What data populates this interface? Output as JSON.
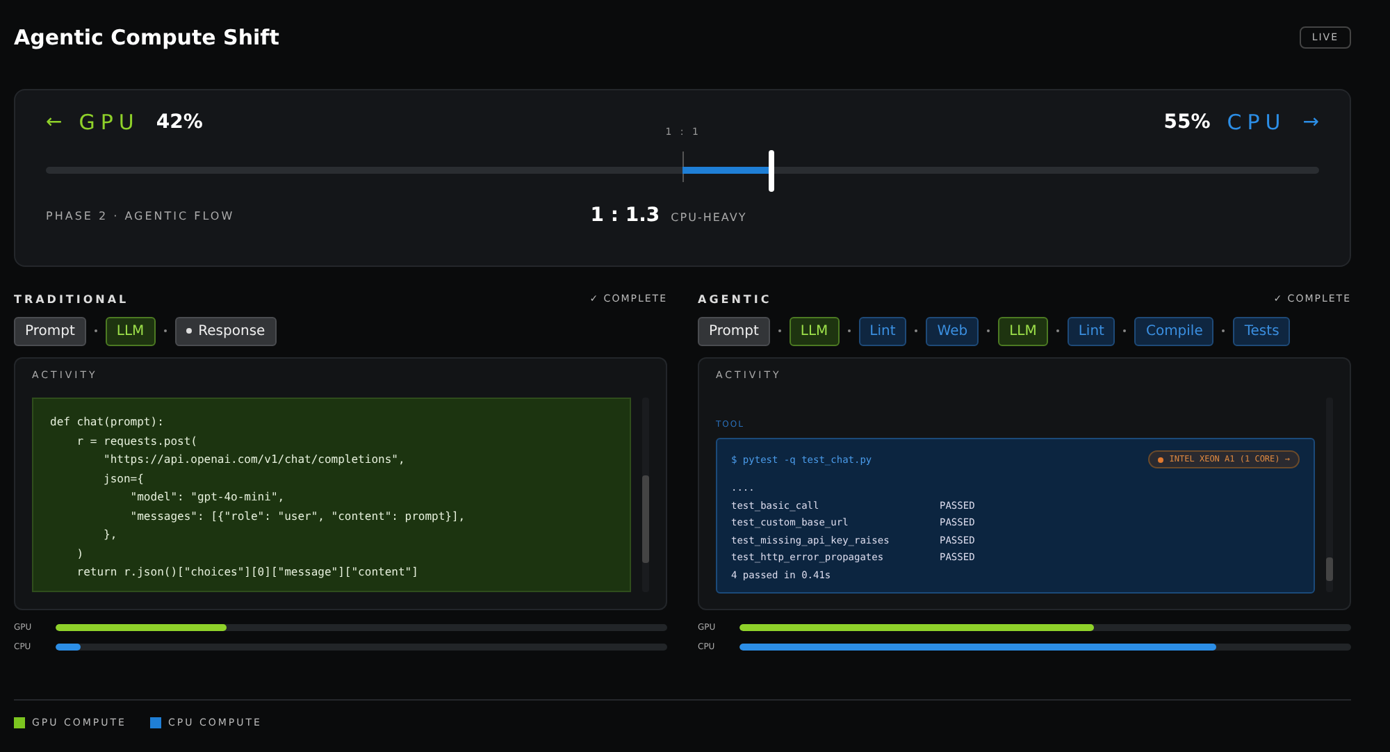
{
  "title": "Agentic Compute Shift",
  "badge": "LIVE",
  "gauge": {
    "left_arrow": "←",
    "left_label": "GPU",
    "left_value": "42%",
    "right_value": "55%",
    "right_label": "CPU",
    "right_arrow": "→",
    "center_label": "1 : 1",
    "level": 0.57,
    "phase": "PHASE 2 · AGENTIC FLOW",
    "ratio": "1 : 1.3",
    "ratio_note": "CPU-HEAVY"
  },
  "panels": [
    {
      "title": "TRADITIONAL",
      "status": "✓ COMPLETE",
      "steps": [
        {
          "label": "Prompt",
          "kind": "neutral",
          "dot": false
        },
        {
          "label": "LLM",
          "kind": "llm",
          "dot": false
        },
        {
          "label": "Response",
          "kind": "neutral",
          "dot": true
        }
      ],
      "activity": {
        "title": "ACTIVITY",
        "kind": "code",
        "lines": [
          "def chat(prompt):",
          "    r = requests.post(",
          "        \"https://api.openai.com/v1/chat/completions\",",
          "        json={",
          "            \"model\": \"gpt-4o-mini\",",
          "            \"messages\": [{\"role\": \"user\", \"content\": prompt}],",
          "        },",
          "    )",
          "    return r.json()[\"choices\"][0][\"message\"][\"content\"]"
        ]
      },
      "meters": [
        {
          "label": "GPU",
          "kind": "gpu",
          "level": 0.28
        },
        {
          "label": "CPU",
          "kind": "cpu",
          "level": 0.04
        }
      ]
    },
    {
      "title": "AGENTIC",
      "status": "✓ COMPLETE",
      "steps": [
        {
          "label": "Prompt",
          "kind": "neutral",
          "dot": false
        },
        {
          "label": "LLM",
          "kind": "llm",
          "dot": false
        },
        {
          "label": "Lint",
          "kind": "tool",
          "dot": false
        },
        {
          "label": "Web",
          "kind": "tool",
          "dot": false
        },
        {
          "label": "LLM",
          "kind": "llm",
          "dot": false
        },
        {
          "label": "Lint",
          "kind": "tool",
          "dot": false
        },
        {
          "label": "Compile",
          "kind": "tool",
          "dot": false
        },
        {
          "label": "Tests",
          "kind": "tool",
          "dot": false
        }
      ],
      "activity": {
        "title": "ACTIVITY",
        "kind": "terminal",
        "section": "TOOL",
        "command": "$ pytest -q test_chat.py",
        "core_badge": "INTEL XEON A1 (1 CORE) →",
        "output": [
          {
            "name": "...."
          },
          {
            "name": "test_basic_call",
            "result": "PASSED"
          },
          {
            "name": "test_custom_base_url",
            "result": "PASSED"
          },
          {
            "name": "test_missing_api_key_raises",
            "result": "PASSED"
          },
          {
            "name": "test_http_error_propagates",
            "result": "PASSED"
          },
          {
            "name": "4 passed in 0.41s"
          }
        ]
      },
      "meters": [
        {
          "label": "GPU",
          "kind": "gpu",
          "level": 0.58
        },
        {
          "label": "CPU",
          "kind": "cpu",
          "level": 0.78
        }
      ]
    }
  ],
  "legend": [
    {
      "label": "GPU COMPUTE",
      "color": "#7cc520"
    },
    {
      "label": "CPU COMPUTE",
      "color": "#1f7fd6"
    }
  ]
}
